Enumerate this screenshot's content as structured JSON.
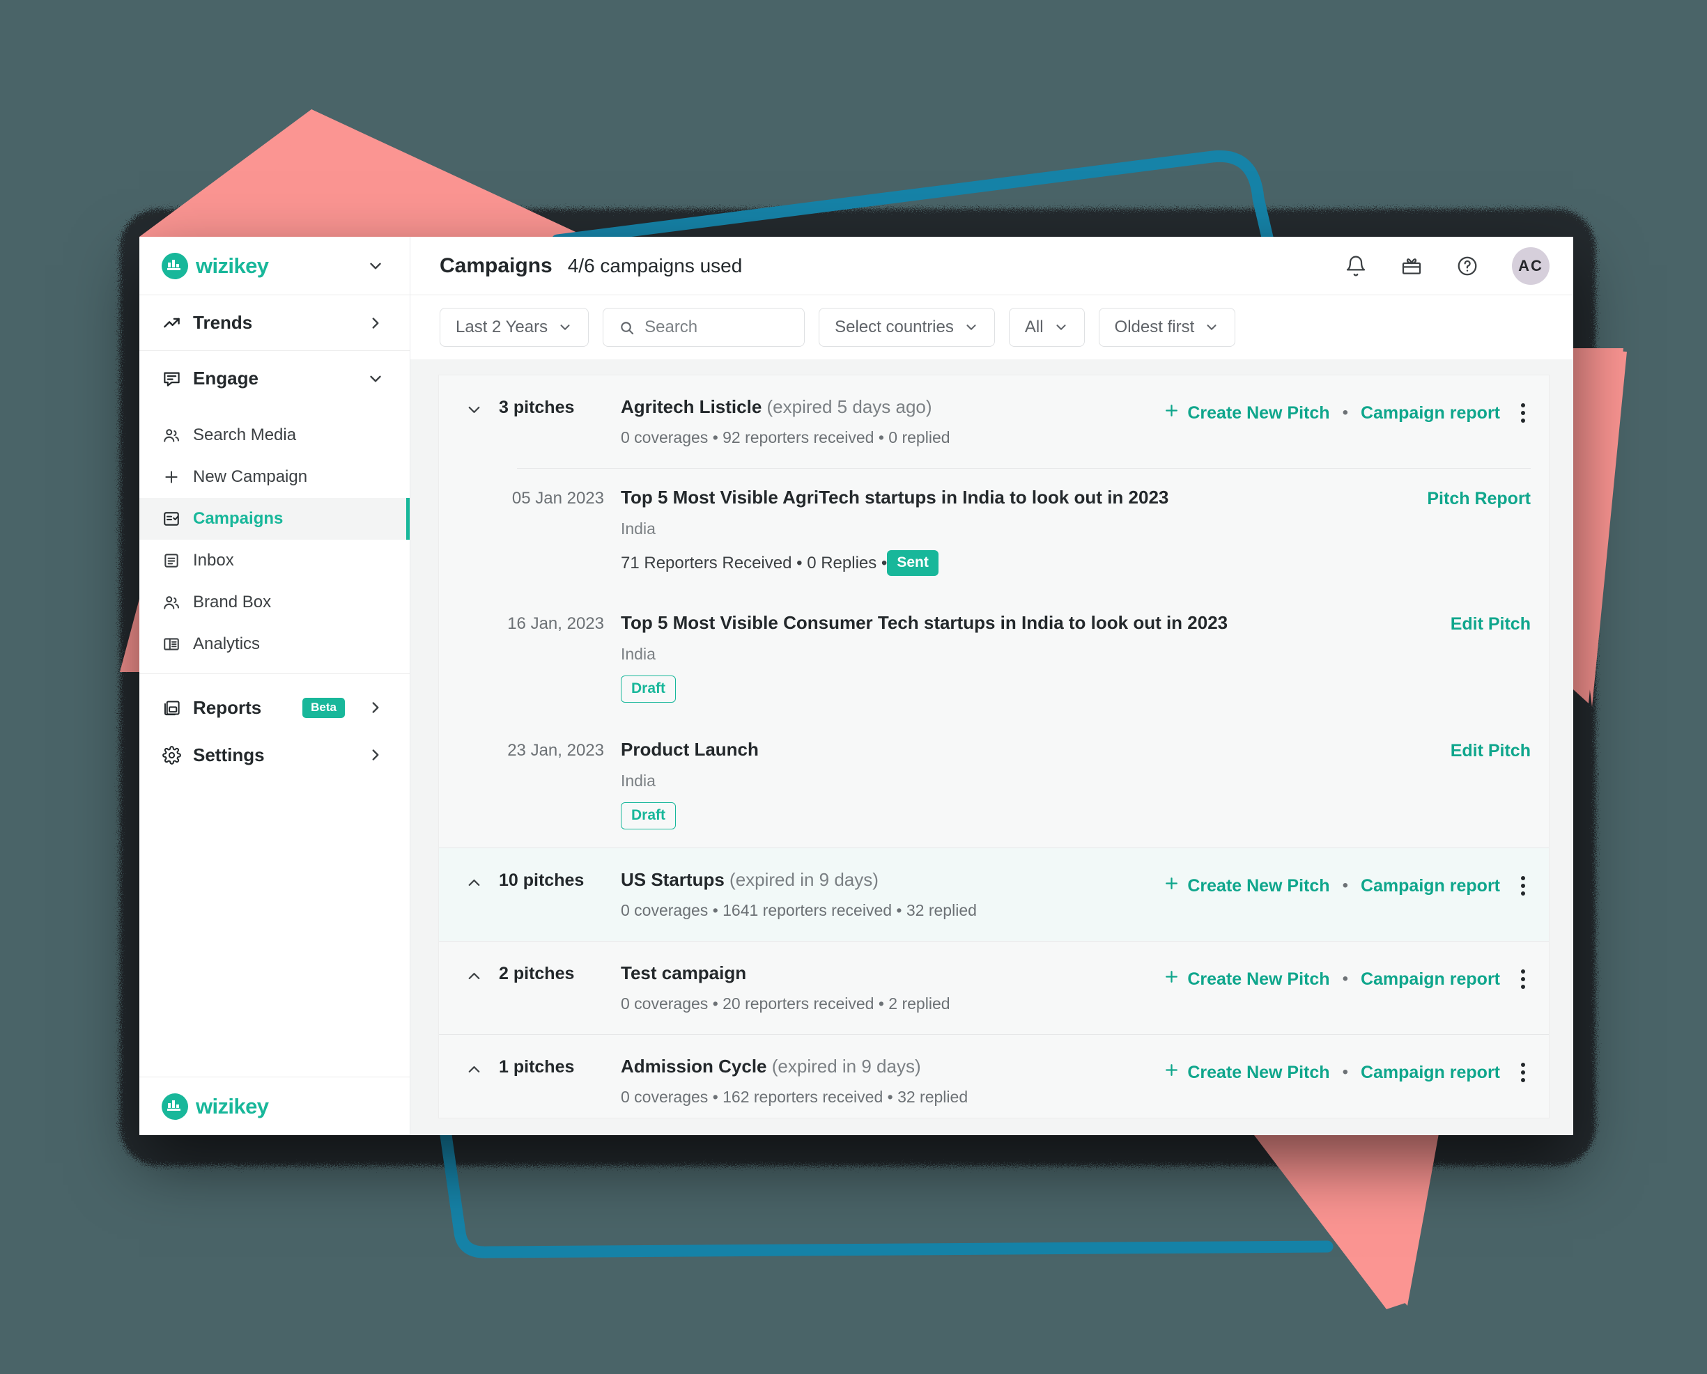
{
  "colors": {
    "background": "#4a6468",
    "brand_teal": "#18b79a",
    "link_teal": "#0fa68c",
    "accent_pink": "#fb9592",
    "accent_blue": "#1683a8",
    "shadow_dark": "#22262a"
  },
  "brand": {
    "name": "wizikey",
    "logo_icon": "wizikey-bars-logo"
  },
  "sidebar": {
    "brand_caret_icon": "chevron-down-icon",
    "groups": [
      {
        "label": "Trends",
        "icon": "trending-up-icon",
        "caret_icon": "chevron-right-icon",
        "items": []
      },
      {
        "label": "Engage",
        "icon": "message-square-icon",
        "caret_icon": "chevron-down-icon",
        "items": [
          {
            "label": "Search Media",
            "icon": "users-icon",
            "active": false
          },
          {
            "label": "New Campaign",
            "icon": "plus-icon",
            "active": false
          },
          {
            "label": "Campaigns",
            "icon": "list-check-icon",
            "active": true
          },
          {
            "label": "Inbox",
            "icon": "inbox-icon",
            "active": false
          },
          {
            "label": "Brand Box",
            "icon": "users-icon",
            "active": false
          },
          {
            "label": "Analytics",
            "icon": "layout-panel-icon",
            "active": false
          }
        ]
      }
    ],
    "bottom_items": [
      {
        "label": "Reports",
        "icon": "file-pdf-icon",
        "badge": "Beta",
        "caret_icon": "chevron-right-icon"
      },
      {
        "label": "Settings",
        "icon": "gear-icon",
        "badge": "",
        "caret_icon": "chevron-right-icon"
      }
    ],
    "footer_brand": "wizikey"
  },
  "topbar": {
    "title": "Campaigns",
    "subtitle": "4/6 campaigns used",
    "icons": [
      {
        "name": "bell-icon"
      },
      {
        "name": "gift-icon"
      },
      {
        "name": "help-circle-icon"
      }
    ],
    "avatar_initials": "AC"
  },
  "filters": {
    "date_range": {
      "label": "Last 2 Years",
      "caret_icon": "chevron-down-icon"
    },
    "search": {
      "placeholder": "Search",
      "value": "",
      "icon": "search-icon"
    },
    "countries": {
      "label": "Select countries",
      "caret_icon": "chevron-down-icon"
    },
    "status": {
      "label": "All",
      "caret_icon": "chevron-down-icon"
    },
    "sort": {
      "label": "Oldest first",
      "caret_icon": "chevron-down-icon"
    }
  },
  "actions": {
    "create_new_pitch": "Create New Pitch",
    "campaign_report": "Campaign report",
    "plus_icon": "plus-icon",
    "separator": "•",
    "kebab_icon": "more-vertical-icon"
  },
  "campaigns": [
    {
      "expanded": true,
      "caret_icon": "chevron-down-icon",
      "pitches_count": "3 pitches",
      "name": "Agritech Listicle",
      "status_note": "(expired 5 days ago)",
      "meta": "0 coverages • 92 reporters received • 0 replied",
      "tinted": false,
      "pitches": [
        {
          "date": "05 Jan 2023",
          "title": "Top 5 Most Visible AgriTech startups in India to look out in 2023",
          "country": "India",
          "stats": "71 Reporters Received  •  0 Replies  •  ",
          "badge": "Sent",
          "badge_type": "sent",
          "action": "Pitch Report"
        },
        {
          "date": "16 Jan, 2023",
          "title": "Top 5 Most Visible Consumer Tech startups in India to look out in 2023",
          "country": "India",
          "stats": "",
          "badge": "Draft",
          "badge_type": "draft",
          "action": "Edit Pitch"
        },
        {
          "date": "23 Jan, 2023",
          "title": "Product Launch",
          "country": "India",
          "stats": "",
          "badge": "Draft",
          "badge_type": "draft",
          "action": "Edit Pitch"
        }
      ]
    },
    {
      "expanded": false,
      "caret_icon": "chevron-up-icon",
      "pitches_count": "10 pitches",
      "name": "US Startups",
      "status_note": "(expired in 9 days)",
      "meta": "0 coverages • 1641 reporters received • 32 replied",
      "tinted": true,
      "pitches": []
    },
    {
      "expanded": false,
      "caret_icon": "chevron-up-icon",
      "pitches_count": "2 pitches",
      "name": "Test campaign",
      "status_note": "",
      "meta": "0 coverages • 20 reporters received • 2 replied",
      "tinted": false,
      "pitches": []
    },
    {
      "expanded": false,
      "caret_icon": "chevron-up-icon",
      "pitches_count": "1 pitches",
      "name": "Admission Cycle",
      "status_note": "(expired in 9 days)",
      "meta": "0 coverages • 162 reporters received • 32 replied",
      "tinted": false,
      "pitches": []
    }
  ]
}
